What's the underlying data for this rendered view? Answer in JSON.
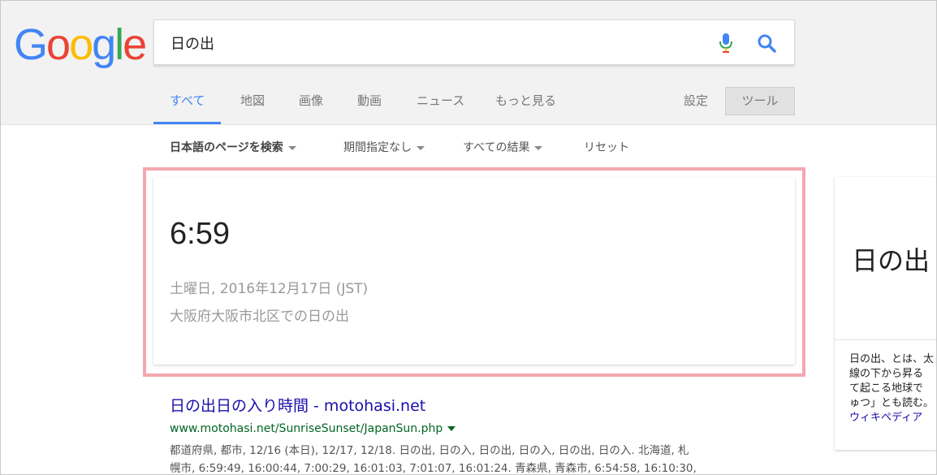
{
  "logo": {
    "letters": [
      "G",
      "o",
      "o",
      "g",
      "l",
      "e"
    ],
    "colors": [
      "#4285f4",
      "#ea4335",
      "#fbbc05",
      "#4285f4",
      "#34a853",
      "#ea4335"
    ]
  },
  "search": {
    "value": "日の出",
    "mic_icon": "microphone-icon",
    "search_icon": "magnifier-icon"
  },
  "tabs": [
    {
      "label": "すべて",
      "active": true
    },
    {
      "label": "地図"
    },
    {
      "label": "画像"
    },
    {
      "label": "動画"
    },
    {
      "label": "ニュース"
    },
    {
      "label": "もっと見る"
    }
  ],
  "settings_label": "設定",
  "tools_label": "ツール",
  "filters": [
    {
      "label": "日本語のページを検索",
      "bold": true,
      "dropdown": true
    },
    {
      "label": "期間指定なし",
      "dropdown": true
    },
    {
      "label": "すべての結果",
      "dropdown": true
    },
    {
      "label": "リセット",
      "dropdown": false
    }
  ],
  "answer_card": {
    "time": "6:59",
    "date": "土曜日, 2016年12月17日 (JST)",
    "location": "大阪府大阪市北区での日の出"
  },
  "knowledge_panel": {
    "title": "日の出",
    "desc_lines": [
      "日の出、とは、太",
      "線の下から昇る",
      "て起こる地球で",
      "ゅつ」とも読む。"
    ],
    "link": "ウィキペディア"
  },
  "result": {
    "title": "日の出日の入り時間 - motohasi.net",
    "url": "www.motohasi.net/SunriseSunset/JapanSun.php",
    "snippet_lines": [
      "都道府県, 都市, 12/16 (本日), 12/17, 12/18. 日の出, 日の入, 日の出, 日の入, 日の出, 日の入. 北海道, 札",
      "幌市, 6:59:49, 16:00:44, 7:00:29, 16:01:03, 7:01:07, 16:01:24. 青森県, 青森市, 6:54:58, 16:10:30,"
    ]
  },
  "colors": {
    "highlight": "#f4a7ae",
    "link": "#1a0dab",
    "url": "#006621",
    "active_tab": "#4285f4"
  }
}
